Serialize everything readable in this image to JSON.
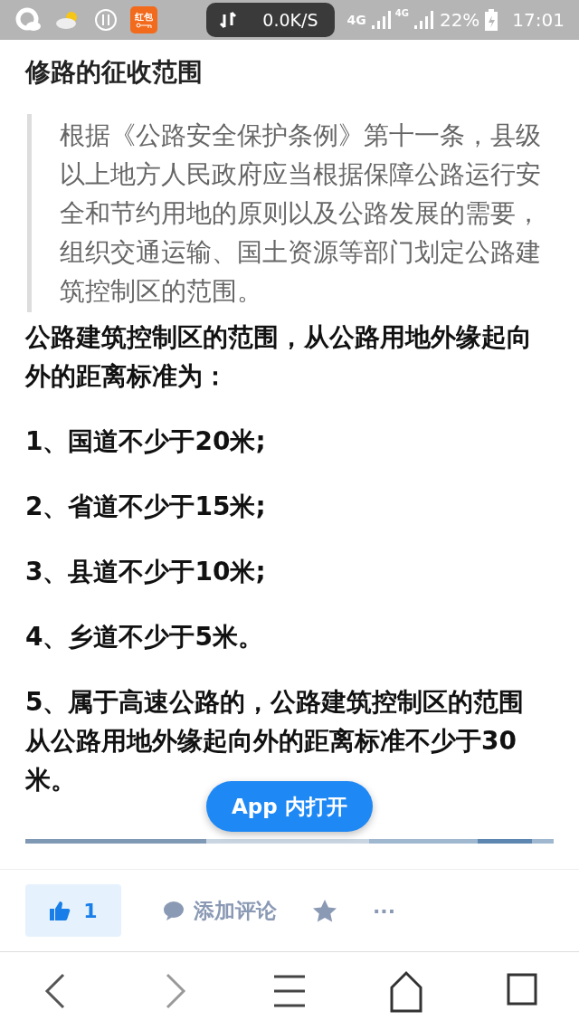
{
  "status_bar": {
    "badge": "红包",
    "speed": "0.0K/S",
    "network": [
      "4G",
      "4G"
    ],
    "battery": "22%",
    "time": "17:01"
  },
  "article": {
    "title": "修路的征收范围",
    "quote": "根据《公路安全保护条例》第十一条，县级以上地方人民政府应当根据保障公路运行安全和节约用地的原则以及公路发展的需要，组织交通运输、国土资源等部门划定公路建筑控制区的范围。",
    "paragraphs": [
      "公路建筑控制区的范围，从公路用地外缘起向外的距离标准为：",
      "1、国道不少于20米;",
      "2、省道不少于15米;",
      "3、县道不少于10米;",
      "4、乡道不少于5米。",
      "5、属于高速公路的，公路建筑控制区的范围从公路用地外缘起向外的距离标准不少于30米。"
    ]
  },
  "open_in_app": "App 内打开",
  "actions": {
    "likes": "1",
    "comment": "添加评论",
    "more": "···"
  }
}
